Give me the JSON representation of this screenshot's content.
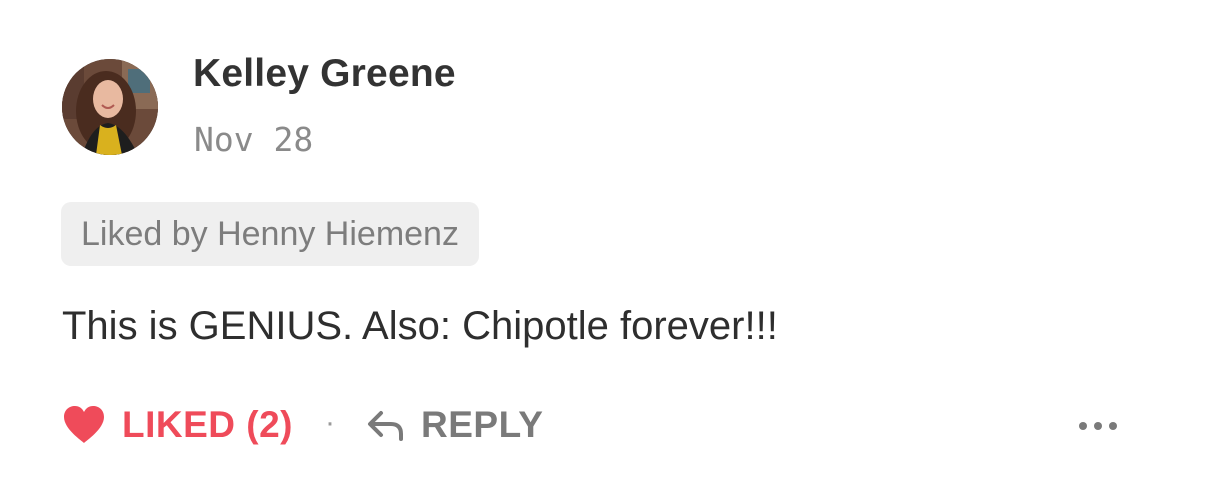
{
  "comment": {
    "author_name": "Kelley Greene",
    "date": "Nov 28",
    "liked_by": "Liked by Henny Hiemenz",
    "body": "This is GENIUS. Also: Chipotle forever!!!"
  },
  "actions": {
    "like_label": "LIKED (2)",
    "separator": "·",
    "reply_label": "REPLY",
    "more_icon": "more-dots-icon",
    "heart_icon": "heart-icon",
    "reply_icon": "reply-arrow-icon"
  },
  "colors": {
    "liked_accent": "#ef4b5a",
    "muted_text": "#7a7a7a",
    "pill_background": "#efefef"
  }
}
